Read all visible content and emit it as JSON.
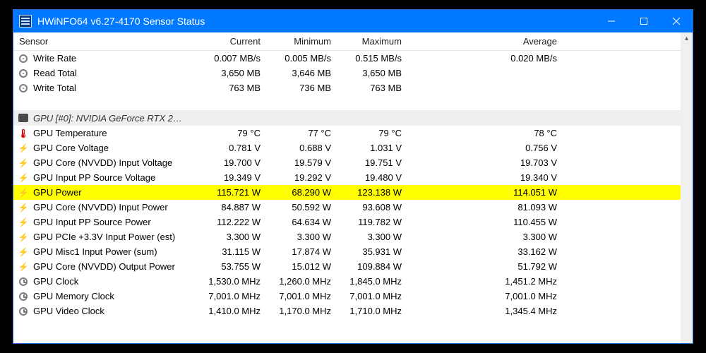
{
  "titlebar": {
    "title": "HWiNFO64 v6.27-4170 Sensor Status"
  },
  "columns": {
    "sensor": "Sensor",
    "cur": "Current",
    "min": "Minimum",
    "max": "Maximum",
    "avg": "Average"
  },
  "top_rows": [
    {
      "icon": "disk",
      "name": "Write Rate",
      "cur": "0.007 MB/s",
      "min": "0.005 MB/s",
      "max": "0.515 MB/s",
      "avg": "0.020 MB/s"
    },
    {
      "icon": "disk",
      "name": "Read Total",
      "cur": "3,650 MB",
      "min": "3,646 MB",
      "max": "3,650 MB",
      "avg": ""
    },
    {
      "icon": "disk",
      "name": "Write Total",
      "cur": "763 MB",
      "min": "736 MB",
      "max": "763 MB",
      "avg": ""
    }
  ],
  "section": {
    "title": "GPU [#0]: NVIDIA GeForce RTX 2…"
  },
  "gpu_rows": [
    {
      "icon": "temp",
      "name": "GPU Temperature",
      "cur": "79 °C",
      "min": "77 °C",
      "max": "79 °C",
      "avg": "78 °C",
      "hl": false
    },
    {
      "icon": "bolt",
      "name": "GPU Core Voltage",
      "cur": "0.781 V",
      "min": "0.688 V",
      "max": "1.031 V",
      "avg": "0.756 V",
      "hl": false
    },
    {
      "icon": "bolt",
      "name": "GPU Core (NVVDD) Input Voltage",
      "cur": "19.700 V",
      "min": "19.579 V",
      "max": "19.751 V",
      "avg": "19.703 V",
      "hl": false
    },
    {
      "icon": "bolt",
      "name": "GPU Input PP Source Voltage",
      "cur": "19.349 V",
      "min": "19.292 V",
      "max": "19.480 V",
      "avg": "19.340 V",
      "hl": false
    },
    {
      "icon": "bolt",
      "name": "GPU Power",
      "cur": "115.721 W",
      "min": "68.290 W",
      "max": "123.138 W",
      "avg": "114.051 W",
      "hl": true
    },
    {
      "icon": "bolt",
      "name": "GPU Core (NVVDD) Input Power",
      "cur": "84.887 W",
      "min": "50.592 W",
      "max": "93.608 W",
      "avg": "81.093 W",
      "hl": false
    },
    {
      "icon": "bolt",
      "name": "GPU Input PP Source Power",
      "cur": "112.222 W",
      "min": "64.634 W",
      "max": "119.782 W",
      "avg": "110.455 W",
      "hl": false
    },
    {
      "icon": "bolt",
      "name": "GPU PCIe +3.3V Input Power (est)",
      "cur": "3.300 W",
      "min": "3.300 W",
      "max": "3.300 W",
      "avg": "3.300 W",
      "hl": false
    },
    {
      "icon": "bolt",
      "name": "GPU Misc1 Input Power (sum)",
      "cur": "31.115 W",
      "min": "17.874 W",
      "max": "35.931 W",
      "avg": "33.162 W",
      "hl": false
    },
    {
      "icon": "bolt",
      "name": "GPU Core (NVVDD) Output Power",
      "cur": "53.755 W",
      "min": "15.012 W",
      "max": "109.884 W",
      "avg": "51.792 W",
      "hl": false
    },
    {
      "icon": "clock",
      "name": "GPU Clock",
      "cur": "1,530.0 MHz",
      "min": "1,260.0 MHz",
      "max": "1,845.0 MHz",
      "avg": "1,451.2 MHz",
      "hl": false
    },
    {
      "icon": "clock",
      "name": "GPU Memory Clock",
      "cur": "7,001.0 MHz",
      "min": "7,001.0 MHz",
      "max": "7,001.0 MHz",
      "avg": "7,001.0 MHz",
      "hl": false
    },
    {
      "icon": "clock",
      "name": "GPU Video Clock",
      "cur": "1,410.0 MHz",
      "min": "1,170.0 MHz",
      "max": "1,710.0 MHz",
      "avg": "1,345.4 MHz",
      "hl": false
    }
  ]
}
